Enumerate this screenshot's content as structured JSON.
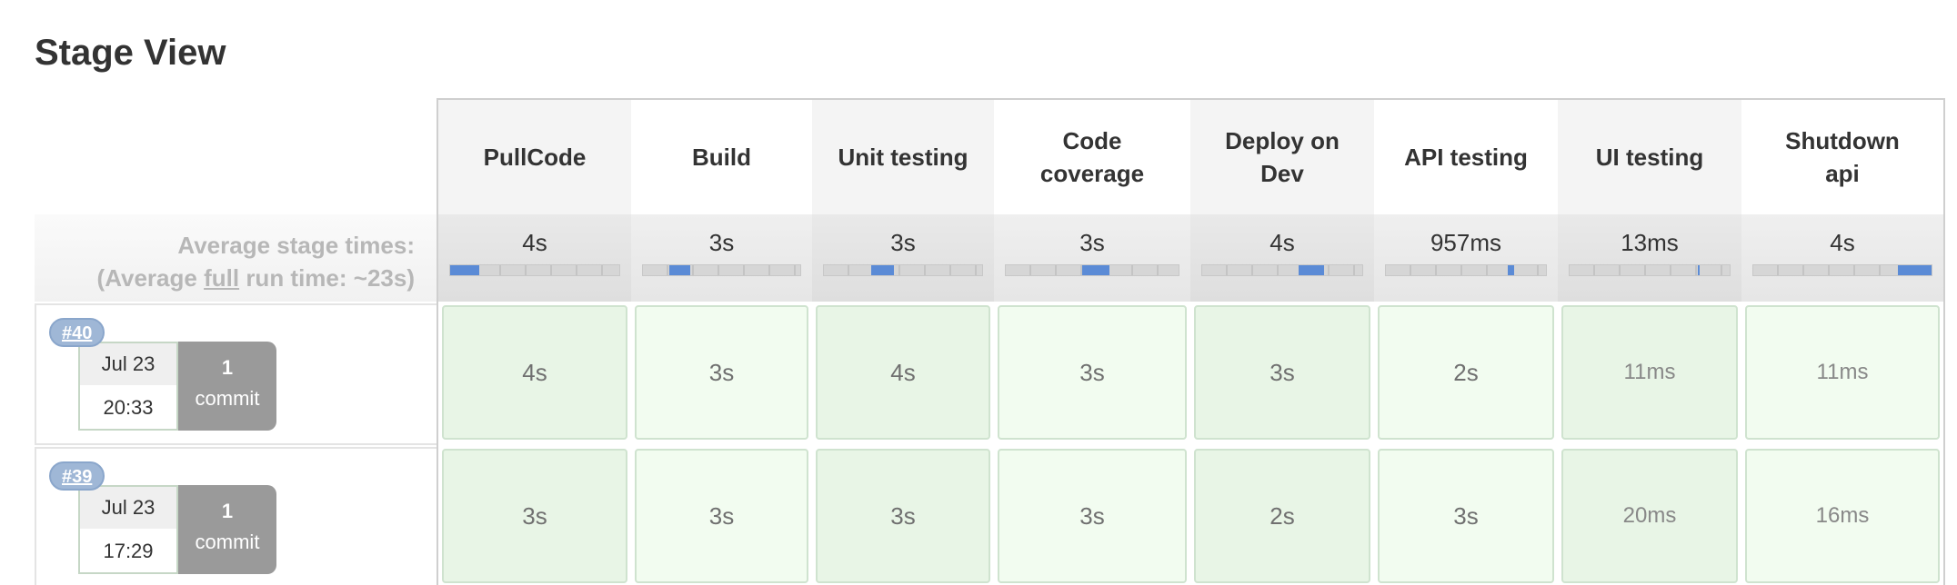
{
  "page": {
    "title": "Stage View"
  },
  "average": {
    "label_line1": "Average stage times:",
    "label_line2_prefix": "(Average ",
    "label_line2_full": "full",
    "label_line2_suffix": " run time: ~23s)"
  },
  "stages": [
    {
      "name_line1": "PullCode",
      "name_line2": "",
      "avg": "4s",
      "avg_progress_start": 0.0,
      "avg_progress_end": 0.17
    },
    {
      "name_line1": "Build",
      "name_line2": "",
      "avg": "3s",
      "avg_progress_start": 0.17,
      "avg_progress_end": 0.3
    },
    {
      "name_line1": "Unit testing",
      "name_line2": "",
      "avg": "3s",
      "avg_progress_start": 0.3,
      "avg_progress_end": 0.44
    },
    {
      "name_line1": "Code",
      "name_line2": "coverage",
      "avg": "3s",
      "avg_progress_start": 0.44,
      "avg_progress_end": 0.6
    },
    {
      "name_line1": "Deploy on",
      "name_line2": "Dev",
      "avg": "4s",
      "avg_progress_start": 0.6,
      "avg_progress_end": 0.76
    },
    {
      "name_line1": "API testing",
      "name_line2": "",
      "avg": "957ms",
      "avg_progress_start": 0.76,
      "avg_progress_end": 0.8
    },
    {
      "name_line1": "UI testing",
      "name_line2": "",
      "avg": "13ms",
      "avg_progress_start": 0.8,
      "avg_progress_end": 0.81
    },
    {
      "name_line1": "Shutdown",
      "name_line2": "api",
      "avg": "4s",
      "avg_progress_start": 0.81,
      "avg_progress_end": 1.0
    }
  ],
  "builds": [
    {
      "number": "#40",
      "date": "Jul 23",
      "time": "20:33",
      "commit_count": "1",
      "commit_label": "commit",
      "durations": [
        "4s",
        "3s",
        "4s",
        "3s",
        "3s",
        "2s",
        "11ms",
        "11ms"
      ]
    },
    {
      "number": "#39",
      "date": "Jul 23",
      "time": "17:29",
      "commit_count": "1",
      "commit_label": "commit",
      "durations": [
        "3s",
        "3s",
        "3s",
        "3s",
        "2s",
        "3s",
        "20ms",
        "16ms"
      ]
    }
  ],
  "colors": {
    "progress_fill": "#5b8bd6",
    "success_cell": "#f2fcf0",
    "success_cell_alt": "#e8f5e6",
    "build_badge": "#9fb7d6",
    "commit_box": "#9a9a9a"
  }
}
